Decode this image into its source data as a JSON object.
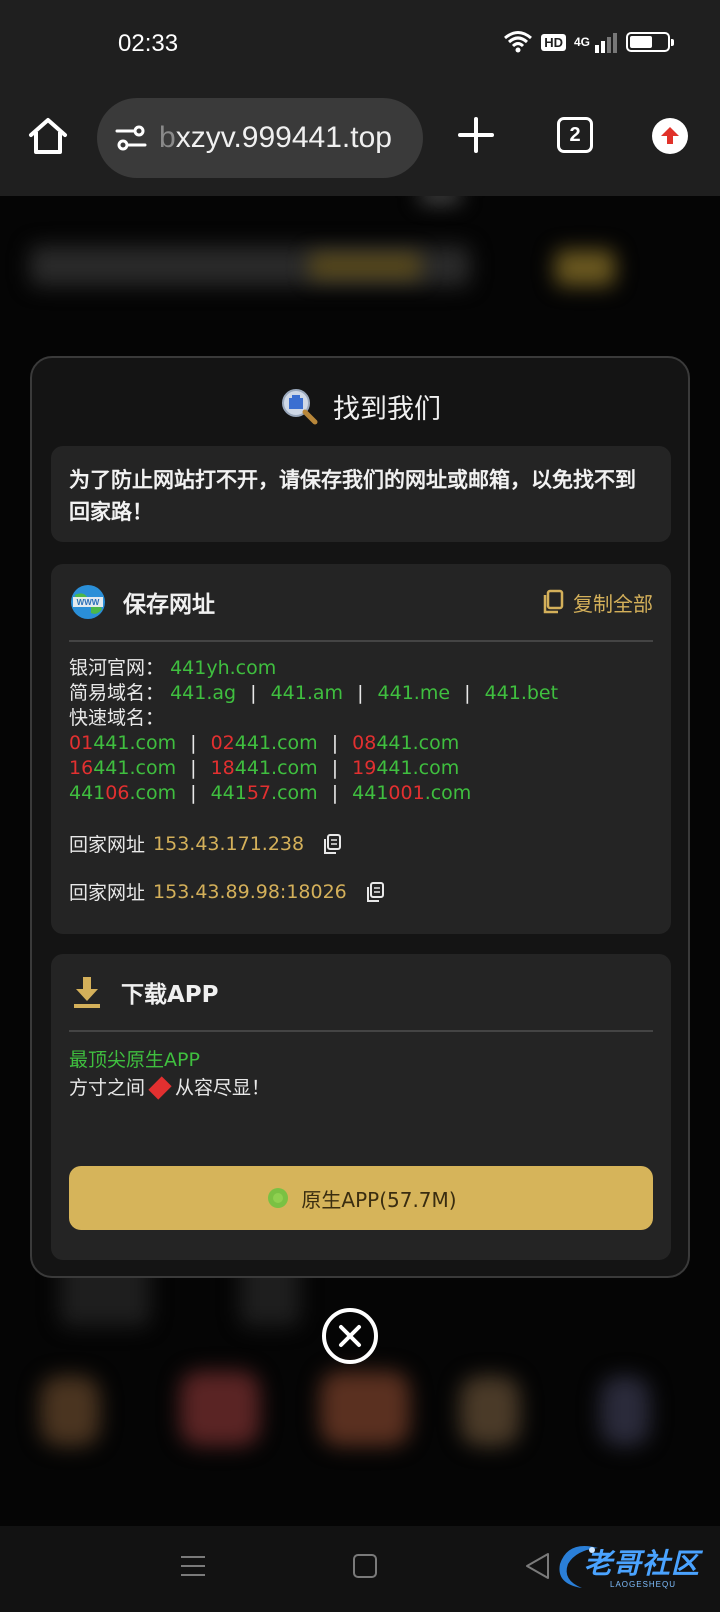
{
  "status_bar": {
    "time": "02:33",
    "hd": "HD",
    "network": "4G",
    "battery_level_pct": 62,
    "icons": [
      "wifi-icon",
      "signal-icon",
      "battery-icon"
    ]
  },
  "browser": {
    "url_faded": "b",
    "url_rest": "xzyv.999441.top",
    "tab_count": "2",
    "icons": [
      "home-icon",
      "tune-icon",
      "plus-icon",
      "upgrade-icon"
    ]
  },
  "modal": {
    "title": "找到我们",
    "title_icon": "search-icon",
    "notice": "为了防止网站打不开，请保存我们的网址或邮箱，以免找不到回家路！",
    "urls_card": {
      "title": "保存网址",
      "icon": "globe-icon",
      "copy_all_label": "复制全部",
      "official_label": "银河官网：",
      "official_url": "441yh.com",
      "simple_label": "简易域名：",
      "simple_urls": [
        "441.ag",
        "441.am",
        "441.me",
        "441.bet"
      ],
      "fast_label": "快速域名：",
      "fast_rows": [
        [
          {
            "r": "01",
            "g": "441.com"
          },
          {
            "r": "02",
            "g": "441.com"
          },
          {
            "r": "08",
            "g": "441.com"
          }
        ],
        [
          {
            "r": "16",
            "g": "441.com"
          },
          {
            "r": "18",
            "g": "441.com"
          },
          {
            "r": "19",
            "g": "441.com"
          }
        ]
      ],
      "fast_row3": [
        {
          "a": "441",
          "b": "06",
          "c": ".com"
        },
        {
          "a": "441",
          "b": "57",
          "c": ".com"
        },
        {
          "a": "441",
          "b": "001",
          "c": ".com"
        }
      ],
      "separator": "|",
      "home_label": "回家网址",
      "home_ip_1": "153.43.171.238",
      "home_ip_2": "153.43.89.98:18026"
    },
    "app_card": {
      "title": "下载APP",
      "icon": "download-icon",
      "line1": "最顶尖原生APP",
      "line2_a": "方寸之间",
      "line2_b": "从容尽显！",
      "button_label": "原生APP(57.7M)",
      "button_icon": "android-icon"
    },
    "close_icon": "close-icon"
  },
  "nav_bar": {
    "icons": [
      "menu-icon",
      "home-square-icon",
      "back-icon"
    ],
    "watermark": "老哥社区",
    "watermark_sub": "LAOGESHEQU"
  },
  "colors": {
    "accent_gold": "#d4b05a",
    "link_green": "#3fbf3f",
    "highlight_red": "#e23030",
    "panel_bg": "#242424",
    "modal_bg": "#141414"
  }
}
